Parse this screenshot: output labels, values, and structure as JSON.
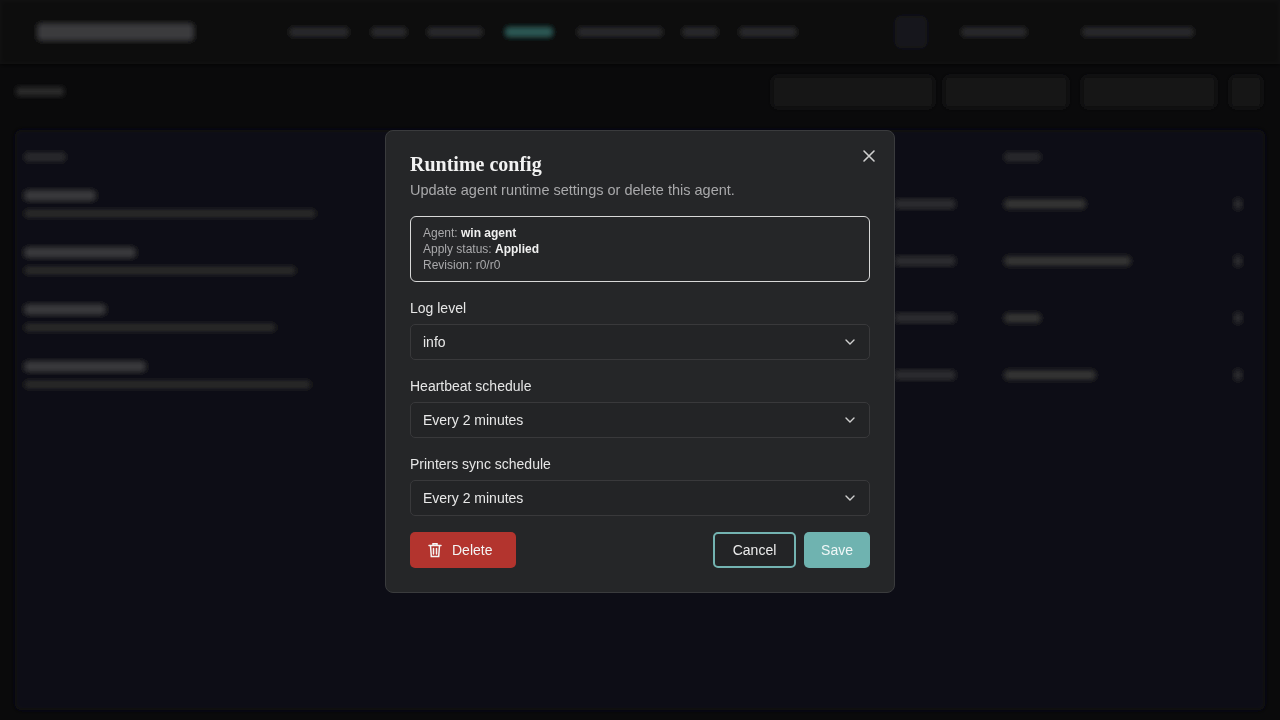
{
  "dialog": {
    "title": "Runtime config",
    "subtitle": "Update agent runtime settings or delete this agent.",
    "summary": [
      "Agent: **win agent**",
      "Apply status: **Applied**",
      "Revision: r0/r0"
    ],
    "fields": [
      {
        "label": "Log level",
        "value": "info"
      },
      {
        "label": "Heartbeat schedule",
        "value": "Every 2 minutes"
      },
      {
        "label": "Printers sync schedule",
        "value": "Every 2 minutes"
      }
    ],
    "buttons": [
      {
        "label": "Delete",
        "kind": "danger"
      },
      {
        "label": "Cancel",
        "kind": "outline"
      },
      {
        "label": "Save",
        "kind": "primary"
      }
    ]
  }
}
